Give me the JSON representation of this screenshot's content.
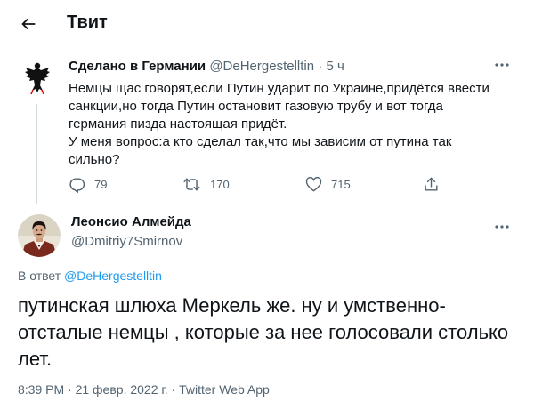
{
  "header": {
    "title": "Твит"
  },
  "parent_tweet": {
    "author_name": "Сделано в Германии",
    "handle": "@DeHergestelltin",
    "separator": "·",
    "time": "5 ч",
    "text_lines": [
      "Немцы щас говорят,если Путин ударит по Украине,придётся ввести",
      "санкции,но тогда Путин остановит газовую трубу и вот тогда",
      "германия пизда настоящая придёт.",
      "У меня вопрос:а кто сделал так,что мы зависим от путина так",
      "сильно?"
    ],
    "stats": {
      "replies": "79",
      "retweets": "170",
      "likes": "715"
    }
  },
  "reply_tweet": {
    "author_name": "Леонсио Алмейда",
    "handle": "@Dmitriy7Smirnov",
    "reply_prefix": "В ответ",
    "reply_mention": "@DeHergestelltin",
    "text_lines": [
      "путинская шлюха Меркель же. ну и умственно-",
      "отсталые немцы , которые за нее голосовали столько",
      "лет."
    ],
    "timestamp": "8:39 PM · 21 февр. 2022 г. · Twitter Web App"
  },
  "icons": {
    "back": "arrow-left-icon",
    "more": "more-horizontal-icon",
    "reply": "reply-icon",
    "retweet": "retweet-icon",
    "like": "heart-icon",
    "share": "share-icon"
  },
  "colors": {
    "text": "#0f1419",
    "secondary": "#536471",
    "link": "#1d9bf0",
    "divider": "#cfd9de"
  }
}
